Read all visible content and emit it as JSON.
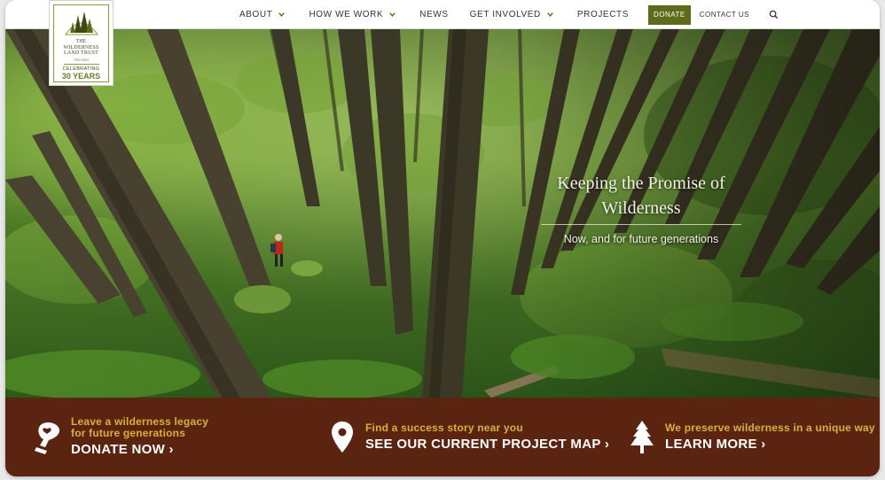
{
  "nav": {
    "items": [
      {
        "label": "ABOUT",
        "has_dropdown": true
      },
      {
        "label": "HOW WE WORK",
        "has_dropdown": true
      },
      {
        "label": "NEWS",
        "has_dropdown": false
      },
      {
        "label": "GET INVOLVED",
        "has_dropdown": true
      },
      {
        "label": "PROJECTS",
        "has_dropdown": false
      }
    ],
    "donate_label": "DONATE",
    "contact_label": "CONTACT US",
    "search_icon": "search-icon"
  },
  "logo": {
    "name_line1": "THE",
    "name_line2": "WILDERNESS",
    "name_line3": "LAND TRUST",
    "years": "1992-2022",
    "celebrating": "CELEBRATING",
    "anniversary": "30 YEARS"
  },
  "hero": {
    "title_line1": "Keeping the Promise of",
    "title_line2": "Wilderness",
    "subtitle": "Now, and for future generations"
  },
  "banner": {
    "ctas": [
      {
        "icon": "hand-heart-icon",
        "small_line1": "Leave a wilderness legacy",
        "small_line2": "for future generations",
        "action": "DONATE NOW ›"
      },
      {
        "icon": "map-pin-icon",
        "small_line1": "Find a success story near you",
        "small_line2": "",
        "action": "SEE OUR CURRENT PROJECT MAP ›"
      },
      {
        "icon": "tree-icon",
        "small_line1": "We preserve wilderness in a unique way",
        "small_line2": "",
        "action": "LEARN MORE ›"
      }
    ]
  },
  "colors": {
    "accent": "#5d6b1a",
    "banner": "#5a2410",
    "banner_highlight": "#d7b13a"
  }
}
